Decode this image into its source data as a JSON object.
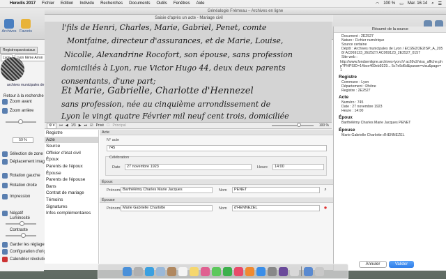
{
  "menubar": {
    "app_name": "Heredis 2017",
    "items": [
      "Fichier",
      "Edition",
      "Individu",
      "Recherches",
      "Documents",
      "Outils",
      "Fenêtres",
      "Aide"
    ],
    "battery": "100 %",
    "clock": "Mar. 16:14"
  },
  "back_window": {
    "toolbar": {
      "archives": "Archives",
      "favoris": "Favoris"
    },
    "tabs": [
      "Registresparoissiaux",
      "Lyon"
    ],
    "tabrow": [
      "Lyon",
      "Lyon 6ème Arron"
    ],
    "logo_text": "archives municipales de Lyon",
    "sidebar": {
      "retour": "Retour à la recherche",
      "zoom_avant": "Zoom avant",
      "zoom_arriere": "Zoom arrière",
      "zoom_value": "59 %",
      "selection": "Sélection de zone",
      "deplacement": "Déplacement image",
      "rotation_gauche": "Rotation gauche",
      "rotation_droite": "Rotation droite",
      "impression": "Impression",
      "negatif": "Négatif",
      "luminosite": "Luminosité",
      "contraste": "Contraste",
      "garder": "Garder les réglages",
      "configuration": "Configuration d'origine",
      "calendrier": "Calendrier révolutionnaire"
    },
    "window_title": "Généalogie Frémeau – Archives en ligne"
  },
  "document_image": {
    "lines": [
      "l'fils de Henri, Charles, Marie, Gabriel, Penet, comte",
      "Montfaine, directeur d'assurances, et de Marie, Louise,",
      "Nicolle, Alexandrine Rocofort, son épouse, sans profession",
      "domiciliés à Lyon, rue Victor Hugo 44, deux deux parents",
      "consentants, d'une part;",
      "Et Marie, Gabrielle, Charlotte d'Hennezel",
      "sans profession, née au cinquième arrondissement de",
      "Lyon le vingt quatre Février mil neuf cent trois, domiciliée"
    ]
  },
  "dialog": {
    "title": "Saisie d'après un acte - Mariage civil",
    "image_toolbar": {
      "page_indicator": "1/3",
      "prive_label": "Privé",
      "principal_label": "Principal",
      "zoom_percent": "100 %"
    },
    "nav_items": [
      "Registre",
      "Acte",
      "Source",
      "Officier d'état civil",
      "Époux",
      "Parents de l'époux",
      "Épouse",
      "Parents de l'épouse",
      "Bans",
      "Contrat de mariage",
      "Témoins",
      "Signatures",
      "Infos complémentaires"
    ],
    "nav_selected": "Acte",
    "acte": {
      "header": "Acte",
      "num_label": "N° acte",
      "num_value": "745",
      "celebration_label": "Célébration",
      "date_label": "Date",
      "date_value": "27 novembre 1923",
      "heure_label": "Heure",
      "heure_value": "14:00"
    },
    "epoux": {
      "header": "Époux",
      "prenoms_label": "Prénoms",
      "prenoms_value": "Barthélémy Charles Marie Jacques",
      "nom_label": "Nom",
      "nom_value": "PENET"
    },
    "epouse": {
      "header": "Épouse",
      "prenoms_label": "Prénoms",
      "prenoms_value": "Marie Gabrielle Charlotte",
      "nom_label": "Nom",
      "nom_value": "d'HENNEZEL"
    },
    "buttons": {
      "cancel": "Annuler",
      "ok": "Valider"
    }
  },
  "summary_panel": {
    "title": "Résumé de la source",
    "document": [
      "Document : 2E2527",
      "Nature : Fichier numérique",
      "Source certaine",
      "Dépôt : Archives municipales de Lyon / EC/2E2/2E2ISP_A_2058/ AC069123_2E2527/ AC069123_2E2527_0157",
      "Site web :"
    ],
    "site_web": "http://www.fondsenligne.archives-lyon.fr/ ac69v2/visu_affiche.php?PHPSID=14bce469eb9329... 5c7e5d6d&param=visu&page=1",
    "registre_head": "Registre",
    "registre": [
      "Commune : Lyon",
      "Département : Rhône",
      "Registre : 2E2527"
    ],
    "acte_head": "Acte",
    "acte": [
      "Numéro : 745",
      "Date : 27 novembre 1923",
      "Heure : 14:00"
    ],
    "epoux_head": "Époux",
    "epoux": "Barthélémy Charles Marie Jacques PENET",
    "epouse_head": "Épouse",
    "epouse": "Marie Gabrielle Charlotte d'HENNEZEL"
  },
  "colors": {
    "accent": "#2f7ee8",
    "nav_selected": "#d5d5d5",
    "delete": "#e03030"
  },
  "dock_icons": [
    "finder-icon",
    "launchpad-icon",
    "safari-icon",
    "mail-icon",
    "contacts-icon",
    "calendar-icon",
    "notes-icon",
    "photos-icon",
    "messages-icon",
    "facetime-icon",
    "music-icon",
    "books-icon",
    "appstore-icon",
    "preferences-icon",
    "heredis-icon",
    "preview-icon",
    "downloads-icon",
    "trash-icon"
  ]
}
